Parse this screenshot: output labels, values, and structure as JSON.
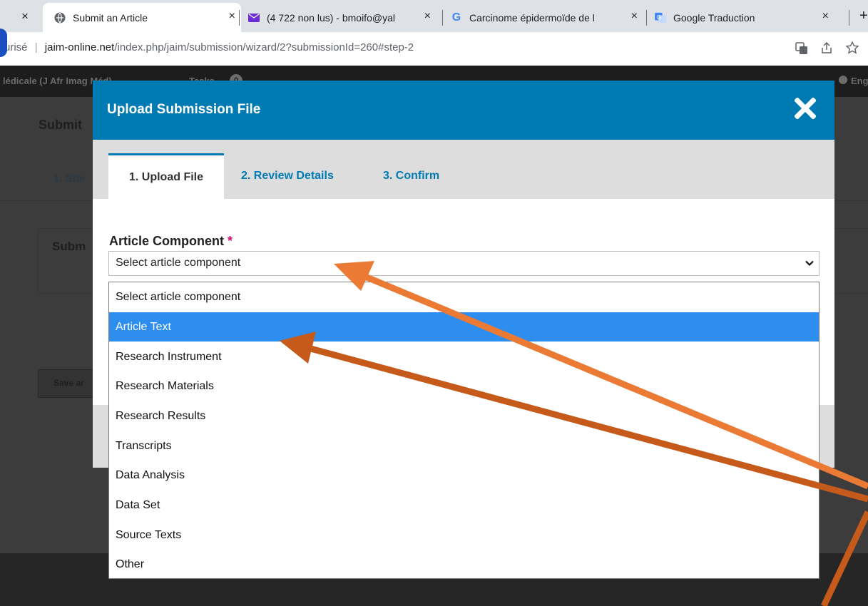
{
  "browser": {
    "tabs": [
      {
        "label": "Submit an Article",
        "active": true
      },
      {
        "label": "(4 722 non lus) - bmoifo@yal",
        "active": false
      },
      {
        "label": "Carcinome épidermoïde de l",
        "active": false
      },
      {
        "label": "Google Traduction",
        "active": false
      }
    ],
    "close_glyph": "×",
    "new_tab_glyph": "+",
    "url_prefix": "urisé",
    "url_separator": "|",
    "url_domain": "jaim-online.net",
    "url_path": "/index.php/jaim/submission/wizard/2?submissionId=260#step-2"
  },
  "site": {
    "journal_short": "lédicale (J Afr Imag Méd)",
    "tasks_label": "Tasks",
    "tasks_count": "0",
    "lang_label": "Eng"
  },
  "background_page": {
    "title": "Submit",
    "step_tab": "1. Star",
    "panel_title": "Subm",
    "save_button": "Save ar"
  },
  "modal": {
    "title": "Upload Submission File",
    "tabs": [
      "1. Upload File",
      "2. Review Details",
      "3. Confirm"
    ],
    "field_label": "Article Component",
    "required_mark": "*",
    "select_value": "Select article component",
    "options": [
      "Select article component",
      "Article Text",
      "Research Instrument",
      "Research Materials",
      "Research Results",
      "Transcripts",
      "Data Analysis",
      "Data Set",
      "Source Texts",
      "Other"
    ],
    "highlighted_option": "Article Text"
  },
  "colors": {
    "modal_header": "#007ab2",
    "highlight": "#2e8ef0",
    "required": "#d00a6c",
    "arrow_light": "#ea7a34",
    "arrow_dark": "#c55a1a"
  },
  "icons": {
    "modal_close": "close-x-icon",
    "select_chevron": "chevron-down-icon",
    "tab_favicons": [
      "globe-icon",
      "mail-icon",
      "google-icon",
      "translate-icon"
    ]
  }
}
